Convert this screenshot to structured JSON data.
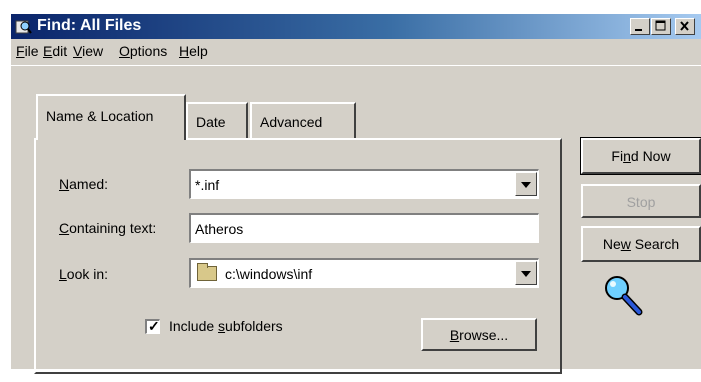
{
  "window": {
    "title": "Find: All Files"
  },
  "menu": [
    {
      "mnemonic": "F",
      "rest": "ile"
    },
    {
      "mnemonic": "E",
      "rest": "dit"
    },
    {
      "mnemonic": "V",
      "rest": "iew"
    },
    {
      "mnemonic": "O",
      "rest": "ptions"
    },
    {
      "mnemonic": "H",
      "rest": "elp"
    }
  ],
  "tabs": {
    "name_location": "Name & Location",
    "date": "Date",
    "advanced": "Advanced"
  },
  "form": {
    "named": {
      "mnemonic": "N",
      "rest": "amed:",
      "value": "*.inf"
    },
    "containing": {
      "mnemonic": "C",
      "rest": "ontaining text:",
      "value": "Atheros"
    },
    "look_in": {
      "mnemonic": "L",
      "rest": "ook in:",
      "value": "c:\\windows\\inf"
    },
    "subfolders": {
      "before": "Include ",
      "mnemonic": "s",
      "after": "ubfolders",
      "checked": true
    }
  },
  "buttons": {
    "find_now": {
      "before": "Fi",
      "mnemonic": "n",
      "after": "d Now"
    },
    "stop": "Stop",
    "new_search": {
      "before": "Ne",
      "mnemonic": "w",
      "after": " Search"
    },
    "browse": {
      "before": "",
      "mnemonic": "B",
      "after": "rowse..."
    }
  },
  "colors": {
    "face": "#d4d0c8",
    "title_start": "#0a246a",
    "title_end": "#a6caf0"
  },
  "icons": [
    "find-window-icon",
    "minimize-icon",
    "maximize-icon",
    "close-icon",
    "folder-icon",
    "checkmark-icon",
    "magnifier-icon",
    "dropdown-arrow-icon"
  ]
}
